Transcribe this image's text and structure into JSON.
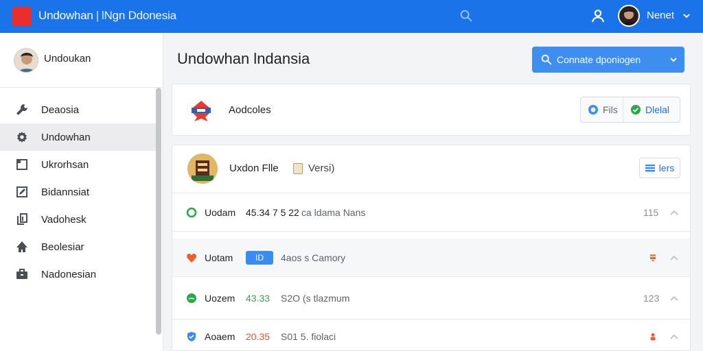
{
  "topbar": {
    "brand": "Undowhan",
    "subtitle": "lNgn Ddonesia",
    "user_name": "Nenet"
  },
  "sidebar": {
    "profile_name": "Undoukan",
    "items": [
      {
        "label": "Deaosia",
        "icon": "wrench-icon"
      },
      {
        "label": "Undowhan",
        "icon": "gear-icon"
      },
      {
        "label": "Ukrorhsan",
        "icon": "frame-icon"
      },
      {
        "label": "Bidannsiat",
        "icon": "edit-icon"
      },
      {
        "label": "Vadohesk",
        "icon": "document-icon"
      },
      {
        "label": "Beolesiar",
        "icon": "home-icon"
      },
      {
        "label": "Nadonesian",
        "icon": "briefcase-icon"
      }
    ],
    "active_index": 1
  },
  "main": {
    "title": "Undowhan lndansia",
    "primary_button": "Connate dponiogen",
    "card1": {
      "label": "Aodcoles",
      "seg_files": "Fils",
      "seg_digital": "Dlelal"
    },
    "card2": {
      "title": "Uxdon Flle",
      "version": "Versi)",
      "button": "lers",
      "rows": [
        {
          "name": "Uodam",
          "value": "45.34 7 5 22",
          "desc": "ca ldama Nans",
          "num": "115",
          "icon": "circle-icon",
          "value_color": "#222222"
        },
        {
          "name": "Uotam",
          "value": "ID",
          "desc": "4aos s Camory",
          "num": "",
          "icon": "heart-icon",
          "value_color": "#ffffff"
        },
        {
          "name": "Uozem",
          "value": "43.33",
          "desc": "S2O (s tlazmum",
          "num": "123",
          "icon": "leaf-icon",
          "value_color": "#2aa84a"
        },
        {
          "name": "Aoaem",
          "value": "20.35",
          "desc": "S01 5. fiolaci",
          "num": "",
          "icon": "shield-icon",
          "value_color": "#e0532a"
        }
      ]
    }
  },
  "colors": {
    "topbar": "#1a73e8",
    "accent": "#3e8ef0",
    "logo": "#ea2e2e"
  }
}
